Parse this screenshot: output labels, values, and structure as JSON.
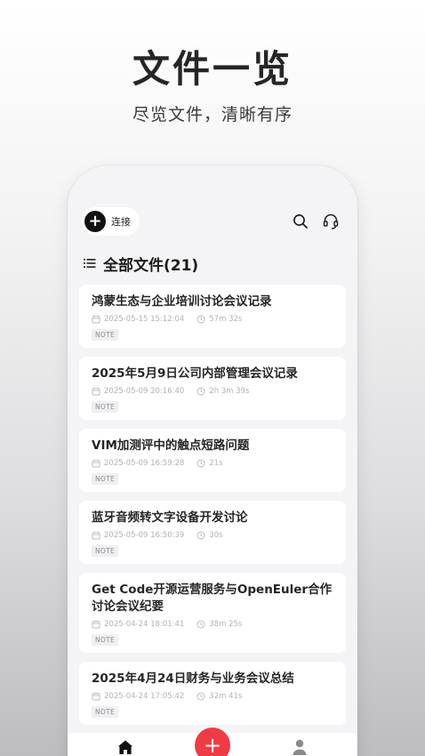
{
  "promo": {
    "title": "文件一览",
    "subtitle": "尽览文件，清晰有序"
  },
  "topbar": {
    "connect_icon": "+",
    "connect_label": "连接",
    "icons": [
      "search-icon",
      "headset-icon"
    ]
  },
  "section": {
    "title": "全部文件(21)",
    "icon": "list-icon"
  },
  "files": [
    {
      "title": "鸿蒙生态与企业培训讨论会议记录",
      "datetime": "2025-05-15 15:12:04",
      "duration": "57m 32s",
      "tag": "NOTE"
    },
    {
      "title": "2025年5月9日公司内部管理会议记录",
      "datetime": "2025-05-09 20:16:40",
      "duration": "2h 3m 39s",
      "tag": "NOTE"
    },
    {
      "title": "VIM加测评中的触点短路问题",
      "datetime": "2025-05-09 16:59:28",
      "duration": "21s",
      "tag": "NOTE"
    },
    {
      "title": "蓝牙音频转文字设备开发讨论",
      "datetime": "2025-05-09 16:50:39",
      "duration": "30s",
      "tag": "NOTE"
    },
    {
      "title": "Get Code开源运营服务与OpenEuler合作讨论会议纪要",
      "datetime": "2025-04-24 18:01:41",
      "duration": "38m 25s",
      "tag": "NOTE"
    },
    {
      "title": "2025年4月24日财务与业务会议总结",
      "datetime": "2025-04-24 17:05:42",
      "duration": "32m 41s",
      "tag": "NOTE"
    }
  ],
  "bottom_nav": {
    "add_icon": "+",
    "icons": [
      "home-icon",
      "add-icon",
      "profile-icon"
    ]
  },
  "colors": {
    "accent": "#ef3b46",
    "connect_button": "#111111"
  }
}
